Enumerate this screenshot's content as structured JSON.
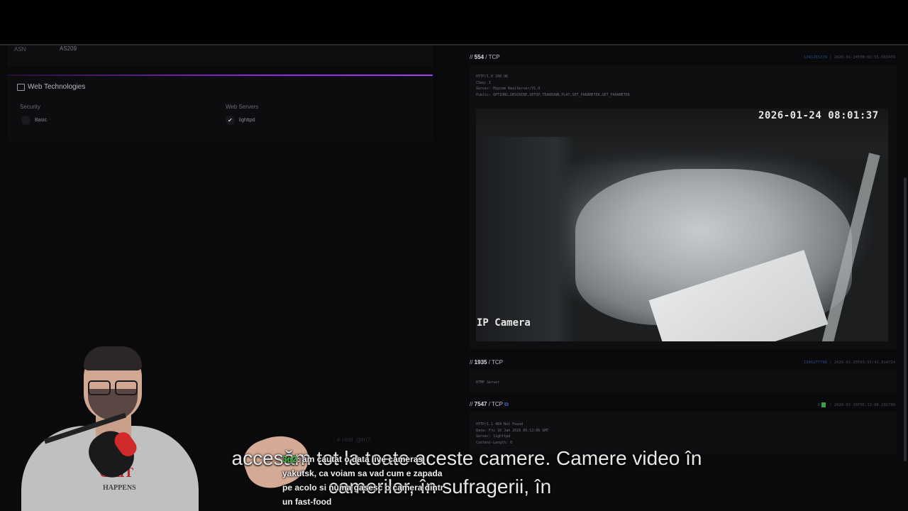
{
  "left": {
    "asn_label": "ASN",
    "asn_value": "AS209",
    "web_technologies_title": "Web Technologies",
    "columns": [
      {
        "label": "Security",
        "items": [
          "Basic"
        ]
      },
      {
        "label": "Web Servers",
        "items": [
          "lighttpd"
        ]
      }
    ]
  },
  "ports": [
    {
      "number": "554",
      "proto": "TCP",
      "hash": "1241255279",
      "timestamp": "2026-01-24T08:02:55.663439",
      "banner": "HTTP/1.0 200 OK\nCSeq: 1\nServer: Hipcam RealServer/V1.0\nPublic: OPTIONS,DESCRIBE,SETUP,TEARDOWN,PLAY,SET_PARAMETER,GET_PARAMETER"
    },
    {
      "number": "1935",
      "proto": "TCP",
      "hash": "1349277798",
      "timestamp": "2026-01-20T03:55:41.814724",
      "banner": "RTMP Server"
    },
    {
      "number": "7547",
      "proto": "TCP",
      "hash": "0",
      "timestamp": "2026-01-16T05:12:06.102700",
      "banner": "HTTP/1.1 404 Not Found\nDate: Fri 16 Jan 2026 05:12:06 GMT\nServer: lighttpd\nContent-Length: 0"
    }
  ],
  "camera": {
    "timestamp": "2026-01-24 08:01:37",
    "label": "IP Camera"
  },
  "overlay": {
    "bg_chat_text": ": e real ,gen?",
    "subtitle_line1": "accesăm tot la toate aceste camere.  Camere video în",
    "subtitle_line2": "camerilor, în sufragerii, în",
    "chat_user": "3q2",
    "chat_message": ": am cautat o data live cameras yakutsk, ca voiam sa vad cum e zapada pe acolo si numa gasesc o camera dintr un fast-food",
    "shirt_line1": "GRIT",
    "shirt_line2": "HAPPENS"
  }
}
